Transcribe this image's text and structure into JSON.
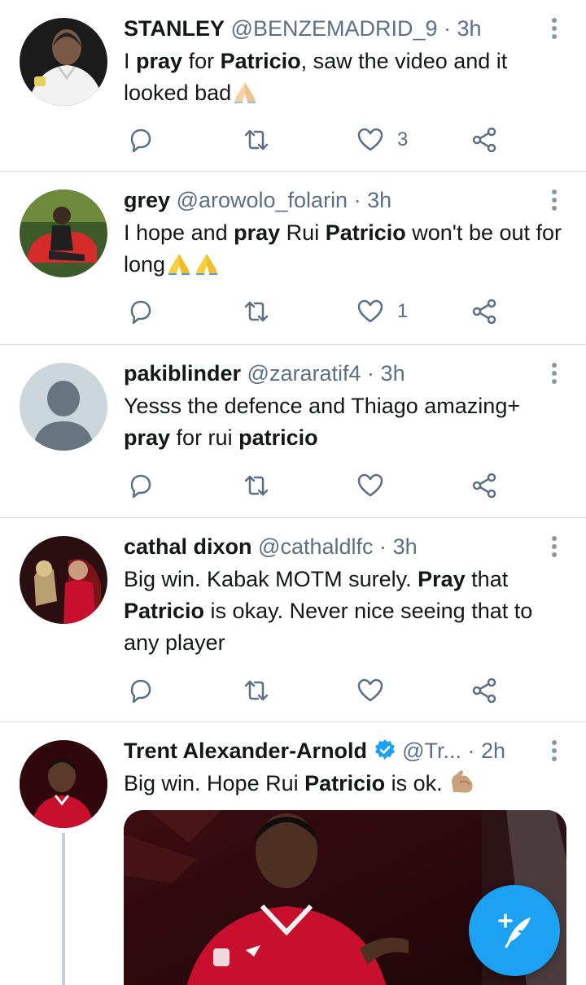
{
  "tweets": [
    {
      "name": "STANLEY",
      "handle": "@BENZEMADRID_9",
      "time": "3h",
      "text_parts": [
        "I ",
        "pray",
        " for ",
        "Patricio",
        ", saw the video and it looked  bad"
      ],
      "emoji": "folded-hands",
      "likes": "3"
    },
    {
      "name": "grey",
      "handle": "@arowolo_folarin",
      "time": "3h",
      "text_parts": [
        "I hope and ",
        "pray",
        " Rui ",
        "Patricio",
        " won't be out for long"
      ],
      "emoji": "folded-hands x2",
      "likes": "1"
    },
    {
      "name": "pakiblinder",
      "handle": "@zararatif4",
      "time": "3h",
      "text_parts": [
        "Yesss the defence and Thiago amazing+ ",
        "pray",
        " for rui ",
        "patricio"
      ],
      "likes": ""
    },
    {
      "name": "cathal dixon",
      "handle": "@cathaldlfc",
      "time": "3h",
      "text_parts": [
        "Big win. Kabak MOTM surely. ",
        "Pray",
        " that ",
        "Patricio",
        " is okay. Never nice seeing that to any player"
      ],
      "likes": ""
    },
    {
      "name": "Trent Alexander-Arnold",
      "handle": "@Tr...",
      "time": "2h",
      "verified": true,
      "text_parts": [
        "Big win. Hope Rui ",
        "Patricio",
        " is ok. "
      ],
      "emoji": "flexed-biceps"
    }
  ],
  "separator": "·",
  "colors": {
    "accent": "#1da1f2",
    "text": "#14171a",
    "secondary": "#5b7083",
    "divider": "#d9dde0"
  },
  "icons": [
    "reply-icon",
    "retweet-icon",
    "like-icon",
    "share-icon",
    "more-icon",
    "verified-icon",
    "compose-icon"
  ]
}
